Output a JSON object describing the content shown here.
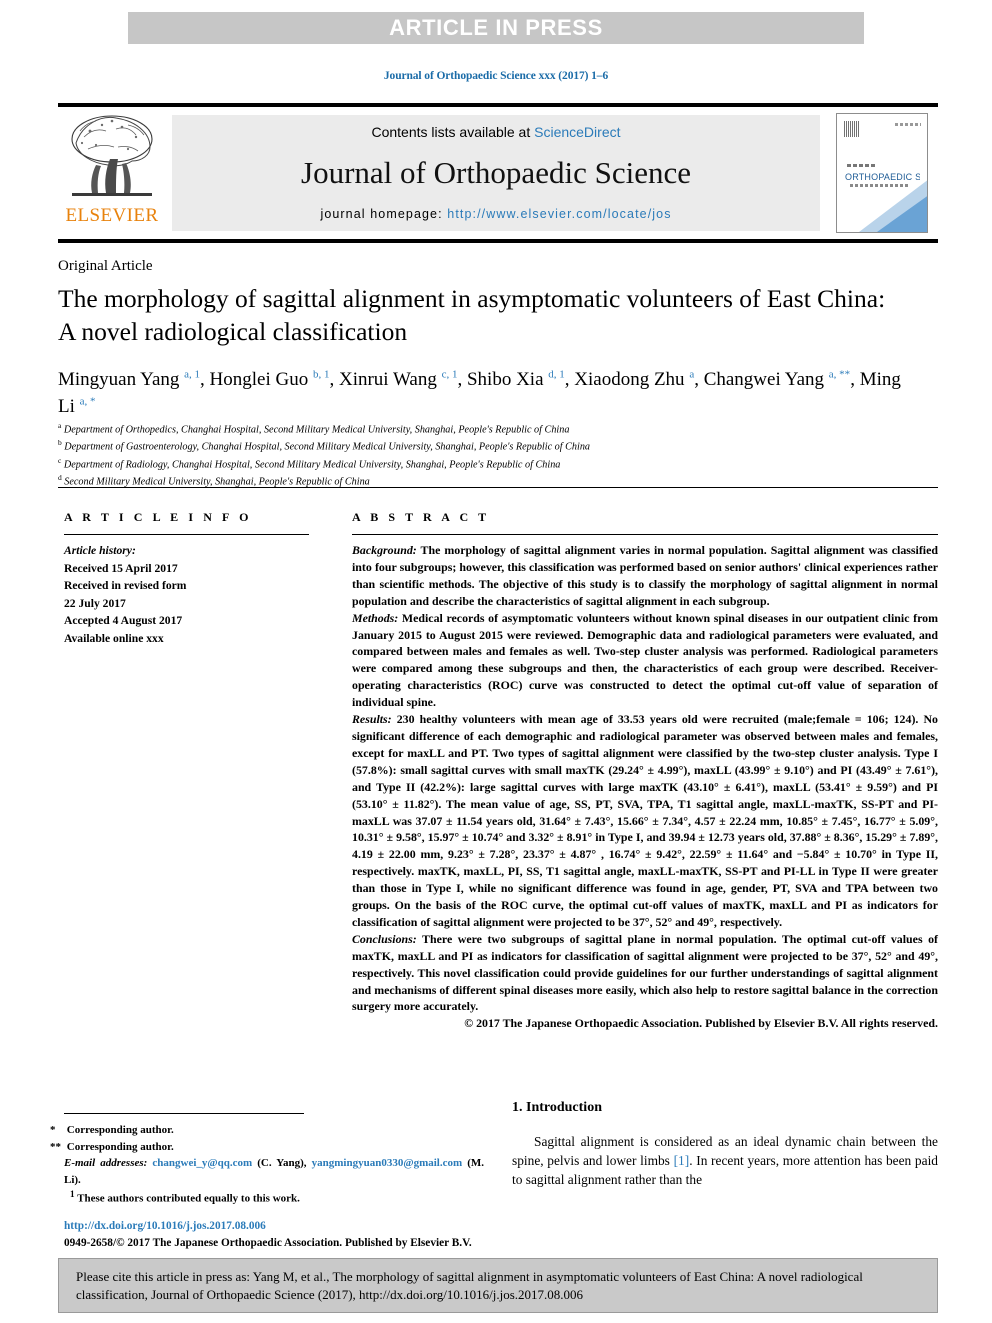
{
  "banner": {
    "text": "ARTICLE IN PRESS"
  },
  "running_head": {
    "text": "Journal of Orthopaedic Science xxx (2017) 1–6"
  },
  "masthead": {
    "contents_prefix": "Contents lists available at ",
    "contents_link": "ScienceDirect",
    "journal_title": "Journal of Orthopaedic Science",
    "homepage_label": "journal homepage: ",
    "homepage_url": "http://www.elsevier.com/locate/jos",
    "publisher_wordmark": "ELSEVIER",
    "cover_title": "ORTHOPAEDIC SCIENCE",
    "colors": {
      "link": "#2b7bb9",
      "elsevier_orange": "#e8820c",
      "banner_gray": "#c6c6c6"
    }
  },
  "article": {
    "type": "Original Article",
    "title": "The morphology of sagittal alignment in asymptomatic volunteers of East China: A novel radiological classification",
    "authors_html": "Mingyuan Yang <sup>a, 1</sup>, Honglei Guo <sup>b, 1</sup>, Xinrui Wang <sup>c, 1</sup>, Shibo Xia <sup>d, 1</sup>, Xiaodong Zhu <sup>a</sup>, Changwei Yang <sup>a, **</sup>, Ming Li <sup>a, *</sup>",
    "affiliations": [
      {
        "mark": "a",
        "text": "Department of Orthopedics, Changhai Hospital, Second Military Medical University, Shanghai, People's Republic of China"
      },
      {
        "mark": "b",
        "text": "Department of Gastroenterology, Changhai Hospital, Second Military Medical University, Shanghai, People's Republic of China"
      },
      {
        "mark": "c",
        "text": "Department of Radiology, Changhai Hospital, Second Military Medical University, Shanghai, People's Republic of China"
      },
      {
        "mark": "d",
        "text": "Second Military Medical University, Shanghai, People's Republic of China"
      }
    ]
  },
  "article_info": {
    "heading": "A R T I C L E  I N F O",
    "history_label": "Article history:",
    "lines": [
      "Received 15 April 2017",
      "Received in revised form",
      "22 July 2017",
      "Accepted 4 August 2017",
      "Available online xxx"
    ]
  },
  "abstract": {
    "heading": "A B S T R A C T",
    "background_label": "Background:",
    "background": " The morphology of sagittal alignment varies in normal population. Sagittal alignment was classified into four subgroups; however, this classification was performed based on senior authors' clinical experiences rather than scientific methods. The objective of this study is to classify the morphology of sagittal alignment in normal population and describe the characteristics of sagittal alignment in each subgroup.",
    "methods_label": "Methods:",
    "methods": " Medical records of asymptomatic volunteers without known spinal diseases in our outpatient clinic from January 2015 to August 2015 were reviewed. Demographic data and radiological parameters were evaluated, and compared between males and females as well. Two-step cluster analysis was performed. Radiological parameters were compared among these subgroups and then, the characteristics of each group were described. Receiver-operating characteristics (ROC) curve was constructed to detect the optimal cut-off value of separation of individual spine.",
    "results_label": "Results:",
    "results": " 230 healthy volunteers with mean age of 33.53 years old were recruited (male;female = 106; 124). No significant difference of each demographic and radiological parameter was observed between males and females, except for maxLL and PT. Two types of sagittal alignment were classified by the two-step cluster analysis. Type I (57.8%): small sagittal curves with small maxTK (29.24° ± 4.99°), maxLL (43.99° ± 9.10°) and PI (43.49° ± 7.61°), and Type II (42.2%): large sagittal curves with large maxTK (43.10° ± 6.41°), maxLL (53.41° ± 9.59°) and PI (53.10° ± 11.82°). The mean value of age, SS, PT, SVA, TPA, T1 sagittal angle, maxLL-maxTK, SS-PT and PI-maxLL was 37.07 ± 11.54 years old, 31.64° ± 7.43°, 15.66° ± 7.34°, 4.57 ± 22.24 mm, 10.85° ± 7.45°, 16.77° ± 5.09°, 10.31° ± 9.58°, 15.97° ± 10.74° and 3.32° ± 8.91° in Type I, and 39.94 ± 12.73 years old, 37.88° ± 8.36°, 15.29° ± 7.89°, 4.19 ± 22.00 mm, 9.23° ± 7.28°, 23.37° ± 4.87° , 16.74° ± 9.42°, 22.59° ± 11.64° and −5.84° ± 10.70° in Type II, respectively. maxTK, maxLL, PI, SS, T1 sagittal angle, maxLL-maxTK, SS-PT and PI-LL in Type II were greater than those in Type I, while no significant difference was found in age, gender, PT, SVA and TPA between two groups. On the basis of the ROC curve, the optimal cut-off values of maxTK, maxLL and PI as indicators for classification of sagittal alignment were projected to be 37°, 52° and 49°, respectively.",
    "conclusions_label": "Conclusions:",
    "conclusions": " There were two subgroups of sagittal plane in normal population. The optimal cut-off values of maxTK, maxLL and PI as indicators for classification of sagittal alignment were projected to be 37°, 52° and 49°, respectively. This novel classification could provide guidelines for our further understandings of sagittal alignment and mechanisms of different spinal diseases more easily, which also help to restore sagittal balance in the correction surgery more accurately.",
    "copyright": "© 2017 The Japanese Orthopaedic Association. Published by Elsevier B.V. All rights reserved."
  },
  "footnotes": {
    "corresponding_1": "Corresponding author.",
    "corresponding_1_mark": "*",
    "corresponding_2": "Corresponding author.",
    "corresponding_2_mark": "**",
    "email_label": "E-mail addresses:",
    "email_1": "changwei_y@qq.com",
    "email_1_owner": "(C. Yang),",
    "email_2": "yangmingyuan0330@gmail.com",
    "email_2_owner": "(M. Li).",
    "equal_contrib_mark": "1",
    "equal_contrib": "These authors contributed equally to this work."
  },
  "doi_block": {
    "doi": "http://dx.doi.org/10.1016/j.jos.2017.08.006",
    "issn_line": "0949-2658/© 2017 The Japanese Orthopaedic Association. Published by Elsevier B.V."
  },
  "introduction": {
    "heading": "1. Introduction",
    "paragraph_part1": "Sagittal alignment is considered as an ideal dynamic chain between the spine, pelvis and lower limbs ",
    "reference": "[1]",
    "paragraph_part2": ". In recent years, more attention has been paid to sagittal alignment rather than the"
  },
  "cite_box": {
    "text": "Please cite this article in press as: Yang M, et al., The morphology of sagittal alignment in asymptomatic volunteers of East China: A novel radiological classification, Journal of Orthopaedic Science (2017), http://dx.doi.org/10.1016/j.jos.2017.08.006"
  }
}
